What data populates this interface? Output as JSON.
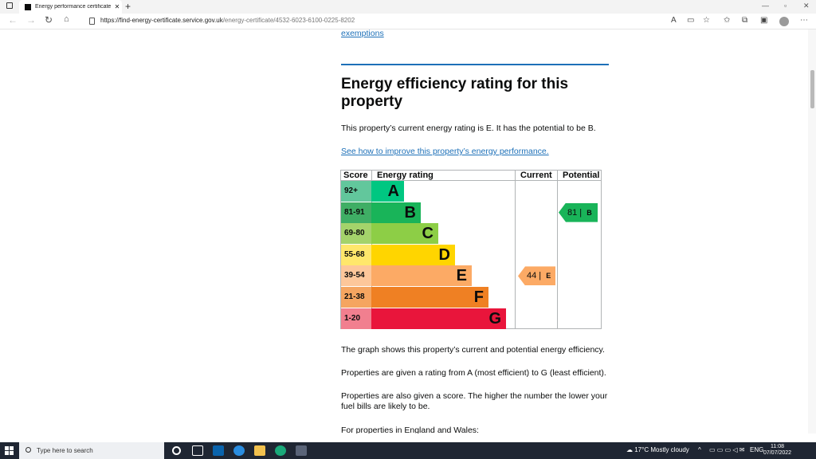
{
  "browser": {
    "tab_title": "Energy performance certificate (",
    "url_host": "https://find-energy-certificate.service.gov.uk",
    "url_path": "/energy-certificate/4532-6023-6100-0225-8202"
  },
  "content": {
    "exemptions_link": "exemptions",
    "heading": "Energy efficiency rating for this property",
    "current_text": "This property’s current energy rating is E. It has the potential to be B.",
    "improve_link": "See how to improve this property’s energy performance.",
    "graph_text": "The graph shows this property’s current and potential energy efficiency.",
    "rating_text": "Properties are given a rating from A (most efficient) to G (least efficient).",
    "score_text": "Properties are also given a score. The higher the number the lower your fuel bills are likely to be.",
    "england_text": "For properties in England and Wales:"
  },
  "epc_chart": {
    "headers": {
      "score": "Score",
      "rating": "Energy rating",
      "current": "Current",
      "potential": "Potential"
    },
    "bands": [
      {
        "range": "92+",
        "letter": "A",
        "color": "#62c79c",
        "bar_color": "#00c781"
      },
      {
        "range": "81-91",
        "letter": "B",
        "color": "#3fae65",
        "bar_color": "#19b459"
      },
      {
        "range": "69-80",
        "letter": "C",
        "color": "#a4d36b",
        "bar_color": "#8dce46"
      },
      {
        "range": "55-68",
        "letter": "D",
        "color": "#ffe76b",
        "bar_color": "#ffd500"
      },
      {
        "range": "39-54",
        "letter": "E",
        "color": "#fdc79a",
        "bar_color": "#fcaa65"
      },
      {
        "range": "21-38",
        "letter": "F",
        "color": "#f5a560",
        "bar_color": "#ef8023"
      },
      {
        "range": "1-20",
        "letter": "G",
        "color": "#f17f8f",
        "bar_color": "#e9153b"
      }
    ],
    "current": {
      "score": "44",
      "letter": "E",
      "color": "#fcaa65"
    },
    "potential": {
      "score": "81",
      "letter": "B",
      "color": "#19b459"
    }
  },
  "taskbar": {
    "search_placeholder": "Type here to search",
    "weather": "17°C  Mostly cloudy",
    "language": "ENG",
    "time": "11:08",
    "date": "07/07/2022"
  }
}
